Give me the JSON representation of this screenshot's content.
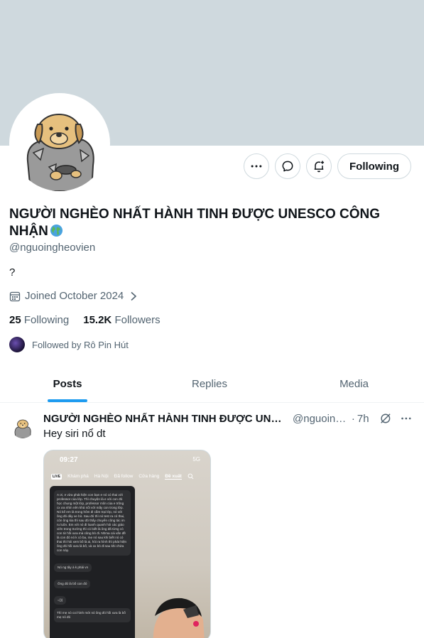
{
  "profile": {
    "name": "NGƯỜI NGHÈO NHẤT HÀNH TINH ĐƯỢC UNESCO CÔNG NHẬN",
    "handle": "@nguoingheovien",
    "bio": "?",
    "joined": "Joined October 2024",
    "following_count": "25",
    "following_label": "Following",
    "followers_count": "15.2K",
    "followers_label": "Followers",
    "followed_by": "Followed by Rô Pin Hút"
  },
  "actions": {
    "more_icon": "more-horizontal-icon",
    "message_icon": "message-bubble-icon",
    "notify_icon": "bell-plus-icon",
    "follow_label": "Following"
  },
  "tabs": [
    {
      "label": "Posts",
      "active": true
    },
    {
      "label": "Replies",
      "active": false
    },
    {
      "label": "Media",
      "active": false
    }
  ],
  "post": {
    "author": "NGƯỜI NGHÈO NHẤT HÀNH TINH ĐƯỢC UNES...",
    "handle": "@nguoing...",
    "time": "7h",
    "text": "Hey siri nổ dt",
    "media": {
      "status_time": "09:27",
      "status_right": "5G",
      "nav_live": "LIVE",
      "nav_items": [
        "Khám phá",
        "Hà Nội",
        "Đã follow",
        "Cửa hàng",
        "Đề xuất"
      ],
      "chat": [
        "A ơi, e vừa phát hiện con bạn e nó có thai với professor của lớp. Thì chuyện là e với con đó học chung một lớp, professor môn của e trông cx ưa nhìn nên khá nổi với mấy con trong lớp. Nó kể em là trong hôm đi cắm trại lớp, nó với ông đó dây xe bò. Sau đó thì nó test ra có thai, còn ông kia thì sau đó thấy chuyển công tác im ru luôn. Em với nó đi loanh quanh hỏi các giáo viên trong trường thì có biết là ông đã từng có con từ hồi xưa mà cũng bỏ đi. Nhma cái vấn đề là con đó nó k có ba, mẹ nó sau khi biết nó có thai thì hỏi xem bố là ai, hỏi ra hình thì phát hiện ông đó hồi xưa là bố, và ox bỏ đi sau khi chửa con này.",
        "Nó ng tây à k phải vn",
        "Ông đó là bố con đó",
        "=)))",
        "Thì mẹ nó coi hình mới nó ông đó hồi xưa là bố mẹ nó đó"
      ]
    }
  },
  "colors": {
    "banner": "#cfd9de",
    "accent": "#1d9bf0",
    "text": "#0f1419",
    "muted": "#536471"
  }
}
